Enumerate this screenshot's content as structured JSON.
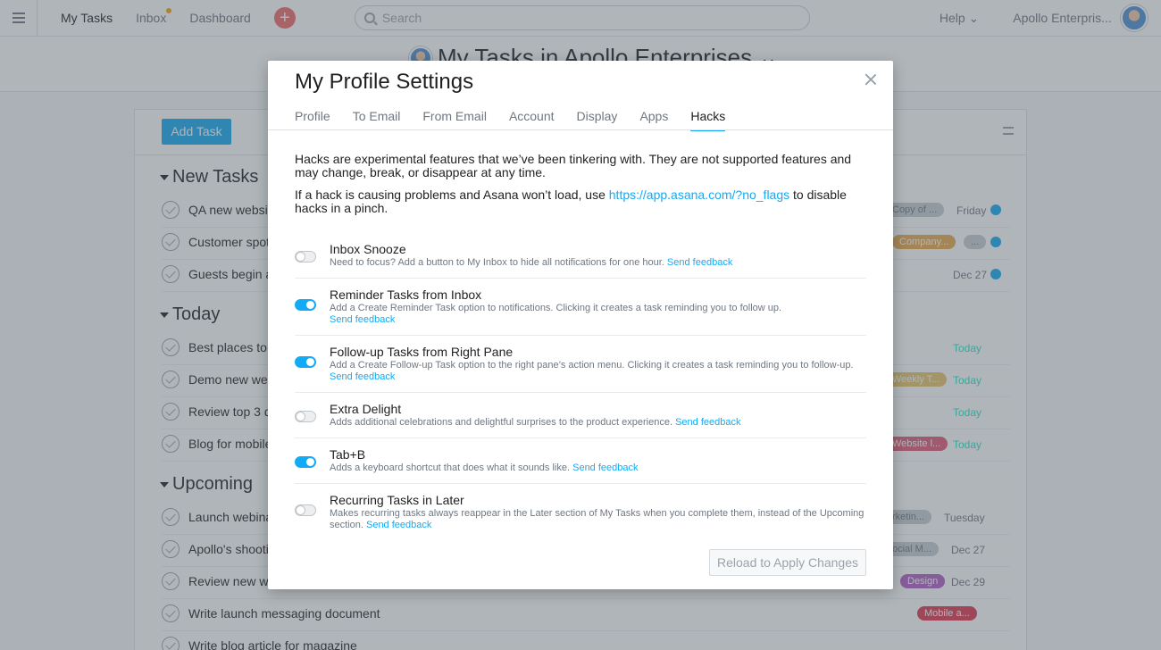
{
  "topbar": {
    "nav": [
      "My Tasks",
      "Inbox",
      "Dashboard"
    ],
    "search_placeholder": "Search",
    "help": "Help ⌄",
    "org": "Apollo Enterpris..."
  },
  "page": {
    "title": "My Tasks in Apollo Enterprises ⌄"
  },
  "tasklist": {
    "add_task": "Add Task",
    "sections": [
      "New Tasks",
      "Today",
      "Upcoming"
    ],
    "tasks": [
      {
        "name": "QA new websit",
        "tag": "Copy of ...",
        "due": "Friday"
      },
      {
        "name": "Customer spot",
        "tag": "Company...",
        "tag2": "...",
        "due": ""
      },
      {
        "name": "Guests begin a",
        "tag": "",
        "due": "Dec 27"
      },
      {
        "name": "Best places to",
        "tag": "",
        "due": "Today"
      },
      {
        "name": "Demo new web",
        "tag": "Weekly T...",
        "due": "Today"
      },
      {
        "name": "Review top 3 d",
        "tag": "",
        "due": "Today"
      },
      {
        "name": "Blog for mobile",
        "tag": "Website l...",
        "due": "Today"
      },
      {
        "name": "Launch webina",
        "tag": "rketin...",
        "due": "Tuesday"
      },
      {
        "name": "Apollo's shooti",
        "tag": "ocial M...",
        "due": "Dec 27"
      },
      {
        "name": "Review new we",
        "tag": "Design",
        "due": "Dec 29"
      },
      {
        "name": "Write launch messaging document",
        "tag": "Mobile a...",
        "due": ""
      },
      {
        "name": "Write blog article for magazine",
        "tag": "",
        "due": ""
      }
    ]
  },
  "modal": {
    "title": "My Profile Settings",
    "tabs": [
      "Profile",
      "To Email",
      "From Email",
      "Account",
      "Display",
      "Apps",
      "Hacks"
    ],
    "intro1": "Hacks are experimental features that we’ve been tinkering with. They are not supported features and may change, break, or disappear at any time.",
    "intro2_pre": "If a hack is causing problems and Asana won’t load, use ",
    "intro2_link": "https://app.asana.com/?no_flags",
    "intro2_post": " to disable hacks in a pinch.",
    "feedback_label": "Send feedback",
    "hacks": [
      {
        "name": "Inbox Snooze",
        "desc": "Need to focus? Add a button to My Inbox to hide all notifications for one hour.",
        "enabled": false
      },
      {
        "name": "Reminder Tasks from Inbox",
        "desc": "Add a Create Reminder Task option to notifications. Clicking it creates a task reminding you to follow up.",
        "enabled": true
      },
      {
        "name": "Follow-up Tasks from Right Pane",
        "desc": "Add a Create Follow-up Task option to the right pane’s action menu. Clicking it creates a task reminding you to follow-up.",
        "enabled": true
      },
      {
        "name": "Extra Delight",
        "desc": "Adds additional celebrations and delightful surprises to the product experience.",
        "enabled": false
      },
      {
        "name": "Tab+B",
        "desc": "Adds a keyboard shortcut that does what it sounds like.",
        "enabled": true
      },
      {
        "name": "Recurring Tasks in Later",
        "desc": "Makes recurring tasks always reappear in the Later section of My Tasks when you complete them, instead of the Upcoming section.",
        "enabled": false
      }
    ],
    "reload_label": "Reload to Apply Changes"
  },
  "colors": {
    "accent": "#14aaf5",
    "overlay": "rgba(80,90,100,0.45)"
  }
}
